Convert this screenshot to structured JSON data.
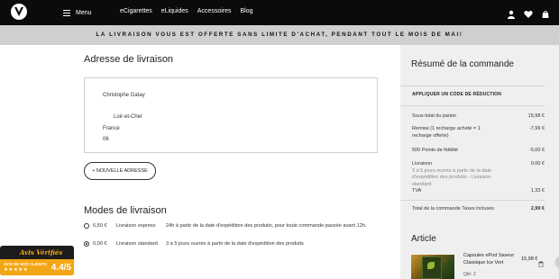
{
  "nav": {
    "menu_label": "Menu",
    "links": [
      "eCigarettes",
      "eLiquides",
      "Accessoires",
      "Blog"
    ]
  },
  "banner": {
    "text": "LA LIVRAISON VOUS EST OFFERTE SANS LIMITE D'ACHAT, PENDANT TOUT LE MOIS DE MAI!"
  },
  "address": {
    "title": "Adresse de livraison",
    "name": "Christophe Gatay",
    "region": "Loir-et-Cher",
    "country": "France",
    "code": "06",
    "new_button": "+ NOUVELLE ADRESSE"
  },
  "shipping": {
    "title": "Modes de livraison",
    "options": [
      {
        "price": "6,50 €",
        "name": "Livraison express",
        "desc": "24h à partir de la date d'expédition des produits, pour toute commande passée avant 12h.",
        "selected": false
      },
      {
        "price": "0,00 €",
        "name": "Livraison standard",
        "desc": "3 à 5 jours ouvrés à partir de la date d'expédition des produits",
        "selected": true
      }
    ]
  },
  "summary": {
    "title": "Résumé de la commande",
    "promo_label": "APPLIQUER UN CODE DE RÉDUCTION",
    "subtotal_label": "Sous-total du panier",
    "subtotal_value": "15,98 €",
    "discount_label": "Remise (1 recharge acheté = 1 recharge offerte)",
    "discount_value": "-7,99 €",
    "points_label": "500 Points de fidélité",
    "points_value": "-5,00 €",
    "shipping_label": "Livraison",
    "shipping_sub": "3 à 5 jours ouvrés à partir de la date d'expédition des produits - Livraison standard",
    "shipping_value": "0,00 €",
    "tva_label": "TVA",
    "tva_value": "1,33 €",
    "total_label": "Total de la commande Taxes incluses",
    "total_value": "2,99 €"
  },
  "article": {
    "title": "Article",
    "name": "Capsules ePod Saveur Classique Ice Vert",
    "qty": "Qté: 2",
    "price": "15,98 €"
  },
  "verified": {
    "logo": "Avis Vérifiés",
    "label": "AVIS DE NOS CLIENTS",
    "stars": "★★★★★",
    "score": "4.4/5"
  },
  "colors": {
    "nav_bg": "#0b0b0b",
    "banner_bg": "#cfcfcf",
    "summary_bg": "#efefef",
    "verified_accent": "#f3a614"
  }
}
